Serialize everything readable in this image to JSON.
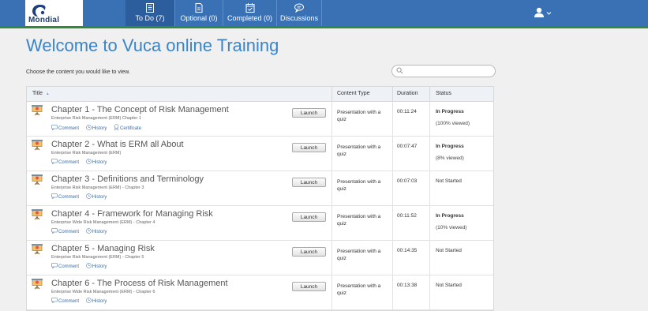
{
  "header": {
    "brand": "Mondial",
    "tabs": [
      {
        "label": "To Do (7)",
        "icon": "list-icon",
        "active": true
      },
      {
        "label": "Optional (0)",
        "icon": "document-icon",
        "active": false
      },
      {
        "label": "Completed (0)",
        "icon": "calendar-check-icon",
        "active": false
      },
      {
        "label": "Discussions",
        "icon": "chat-icon",
        "active": false
      }
    ],
    "user_icon": "user-icon"
  },
  "page": {
    "title": "Welcome to Vuca online Training",
    "subtitle": "Choose the content you would like to view.",
    "search_placeholder": ""
  },
  "table": {
    "columns": {
      "title": "Title",
      "title_sort_glyph": "▲",
      "content_type": "Content Type",
      "duration": "Duration",
      "status": "Status"
    },
    "launch_label": "Launch",
    "comment_label": "Comment",
    "history_label": "History",
    "certificate_label": "Certificate",
    "rows": [
      {
        "title": "Chapter 1 - The Concept of Risk Management",
        "desc": "Enterprise Risk Management (ERM) Chapter 1",
        "type": "Presentation with a quiz",
        "duration": "00:11:24",
        "status": "In Progress",
        "viewed": "(100% viewed)",
        "certificate": true
      },
      {
        "title": "Chapter 2 - What is ERM all About",
        "desc": "Enterprise Risk Management (ERM)",
        "type": "Presentation with a quiz",
        "duration": "00:07:47",
        "status": "In Progress",
        "viewed": "(8% viewed)",
        "certificate": false
      },
      {
        "title": "Chapter 3 - Definitions and Terminology",
        "desc": "Enterprise Risk Management (ERM) - Chapter 3",
        "type": "Presentation with a quiz",
        "duration": "00:07:03",
        "status": "Not Started",
        "viewed": "",
        "certificate": false
      },
      {
        "title": "Chapter 4 - Framework for Managing Risk",
        "desc": "Enterprise Wide Risk Management (ERM) - Chapter 4",
        "type": "Presentation with a quiz",
        "duration": "00:11:52",
        "status": "In Progress",
        "viewed": "(10% viewed)",
        "certificate": false
      },
      {
        "title": "Chapter 5 - Managing Risk",
        "desc": "Enterprise Risk Management (ERM) - Chapter 5",
        "type": "Presentation with a quiz",
        "duration": "00:14:35",
        "status": "Not Started",
        "viewed": "",
        "certificate": false
      },
      {
        "title": "Chapter 6 - The Process of Risk Management",
        "desc": "Enterprise Wide Risk Management (ERM) - Chapter 6",
        "type": "Presentation with a quiz",
        "duration": "00:13:38",
        "status": "Not Started",
        "viewed": "",
        "certificate": false
      }
    ]
  },
  "colors": {
    "header_bg": "#3a71b4",
    "header_accent": "#2f8a3a",
    "title": "#3a84c8",
    "link": "#3a6ea8"
  }
}
